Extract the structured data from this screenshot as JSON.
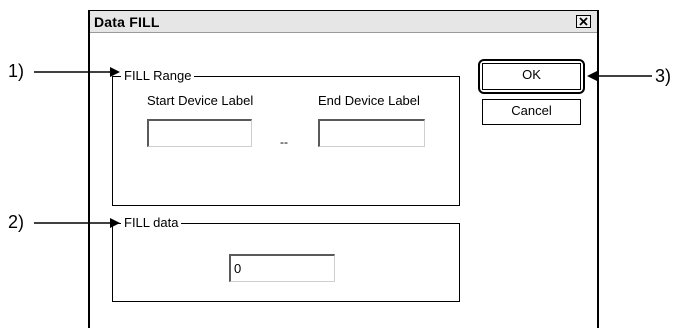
{
  "dialog": {
    "title": "Data FILL",
    "close_icon": "close-x-icon"
  },
  "fill_range": {
    "legend": "FILL Range",
    "start_label": "Start Device Label",
    "end_label": "End Device Label",
    "start_value": "",
    "end_value": "",
    "separator": "--"
  },
  "fill_data": {
    "legend": "FILL data",
    "value": "0"
  },
  "buttons": {
    "ok": "OK",
    "cancel": "Cancel"
  },
  "callouts": {
    "c1": "1)",
    "c2": "2)",
    "c3": "3)"
  }
}
